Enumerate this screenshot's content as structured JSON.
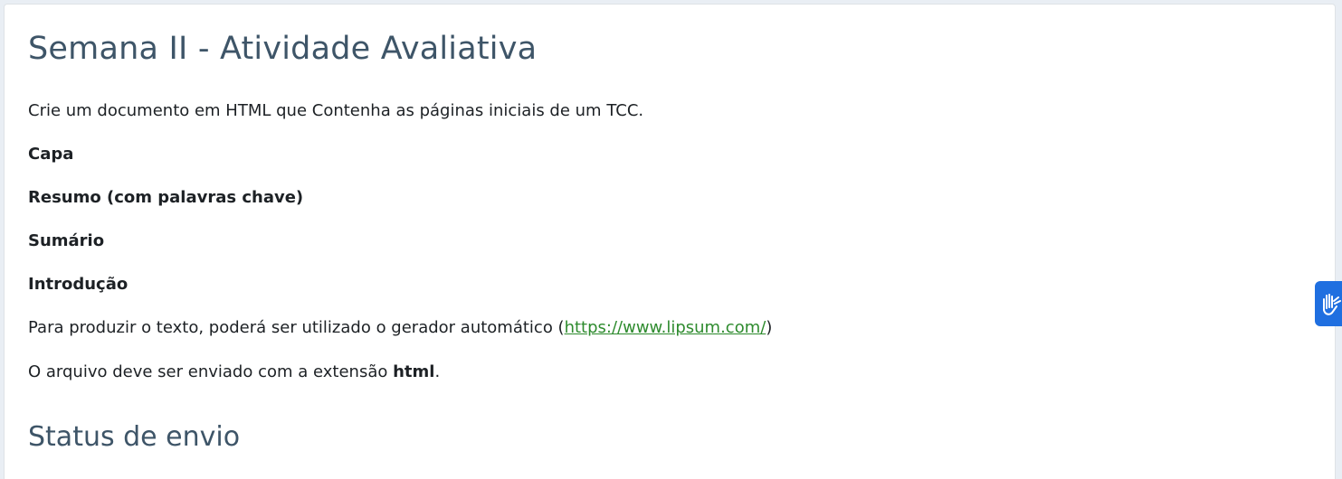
{
  "activity": {
    "title": "Semana II - Atividade Avaliativa",
    "intro": "Crie um documento em HTML que Contenha as páginas iniciais de um TCC.",
    "items": [
      "Capa",
      "Resumo (com palavras chave)",
      "Sumário",
      "Introdução"
    ],
    "generator_prefix": "Para produzir o texto, poderá ser utilizado o gerador automático (",
    "generator_link": "https://www.lipsum.com/",
    "generator_suffix": ")",
    "extension_prefix": "O arquivo deve ser enviado com a extensão ",
    "extension_bold": "html",
    "extension_suffix": "."
  },
  "status": {
    "heading": "Status de envio"
  },
  "accessibility_widget": {
    "icon": "sign-language-hands-icon",
    "color": "#1f6fe0"
  },
  "colors": {
    "heading": "#3e5568",
    "text": "#1d2125",
    "link": "#2e8b2e"
  }
}
